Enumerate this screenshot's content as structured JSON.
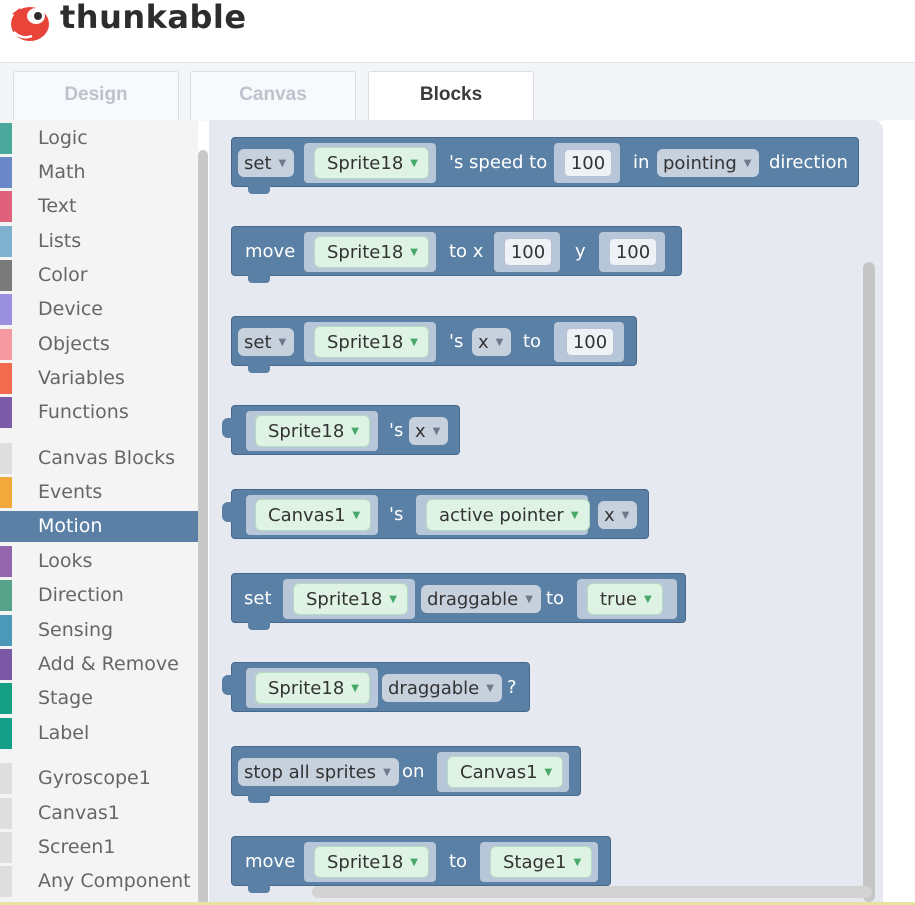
{
  "brand": "thunkable",
  "tabs": [
    "Design",
    "Canvas",
    "Blocks"
  ],
  "categories": {
    "logic": "Logic",
    "math": "Math",
    "text": "Text",
    "lists": "Lists",
    "color": "Color",
    "device": "Device",
    "objects": "Objects",
    "variables": "Variables",
    "functions": "Functions",
    "canvas_blocks": "Canvas Blocks",
    "events": "Events",
    "motion": "Motion",
    "looks": "Looks",
    "direction": "Direction",
    "sensing": "Sensing",
    "add_remove": "Add & Remove",
    "stage": "Stage",
    "label": "Label",
    "gyroscope": "Gyroscope1",
    "canvas1": "Canvas1",
    "screen1": "Screen1",
    "any_component": "Any Component"
  },
  "colors": {
    "logic": "#4aa99a",
    "math": "#6a88c8",
    "text": "#e0617c",
    "lists": "#7fb1cf",
    "color": "#7a7a7a",
    "device": "#9b8fe0",
    "objects": "#f59aa0",
    "variables": "#f26b4e",
    "functions": "#7b5ba8",
    "events": "#f2a93b",
    "looks": "#9466ad",
    "direction": "#57a38a",
    "sensing": "#4b98b8",
    "add_remove": "#7a58a6",
    "stage": "#15a083",
    "label": "#14a088",
    "block": "#5b80a5"
  },
  "b": {
    "set": "set",
    "sprite": "Sprite18",
    "speed_to": "'s speed to",
    "hundred": "100",
    "in": "in",
    "pointing": "pointing",
    "direction": "direction",
    "move": "move",
    "to_x": "to x",
    "y": "y",
    "s": "'s",
    "x": "x",
    "to": "to",
    "canvas": "Canvas1",
    "active_pointer": "active pointer",
    "draggable": "draggable",
    "true": "true",
    "q": "?",
    "stop_all": "stop all sprites",
    "on": "on",
    "stage": "Stage1",
    "arrow": "▼"
  }
}
